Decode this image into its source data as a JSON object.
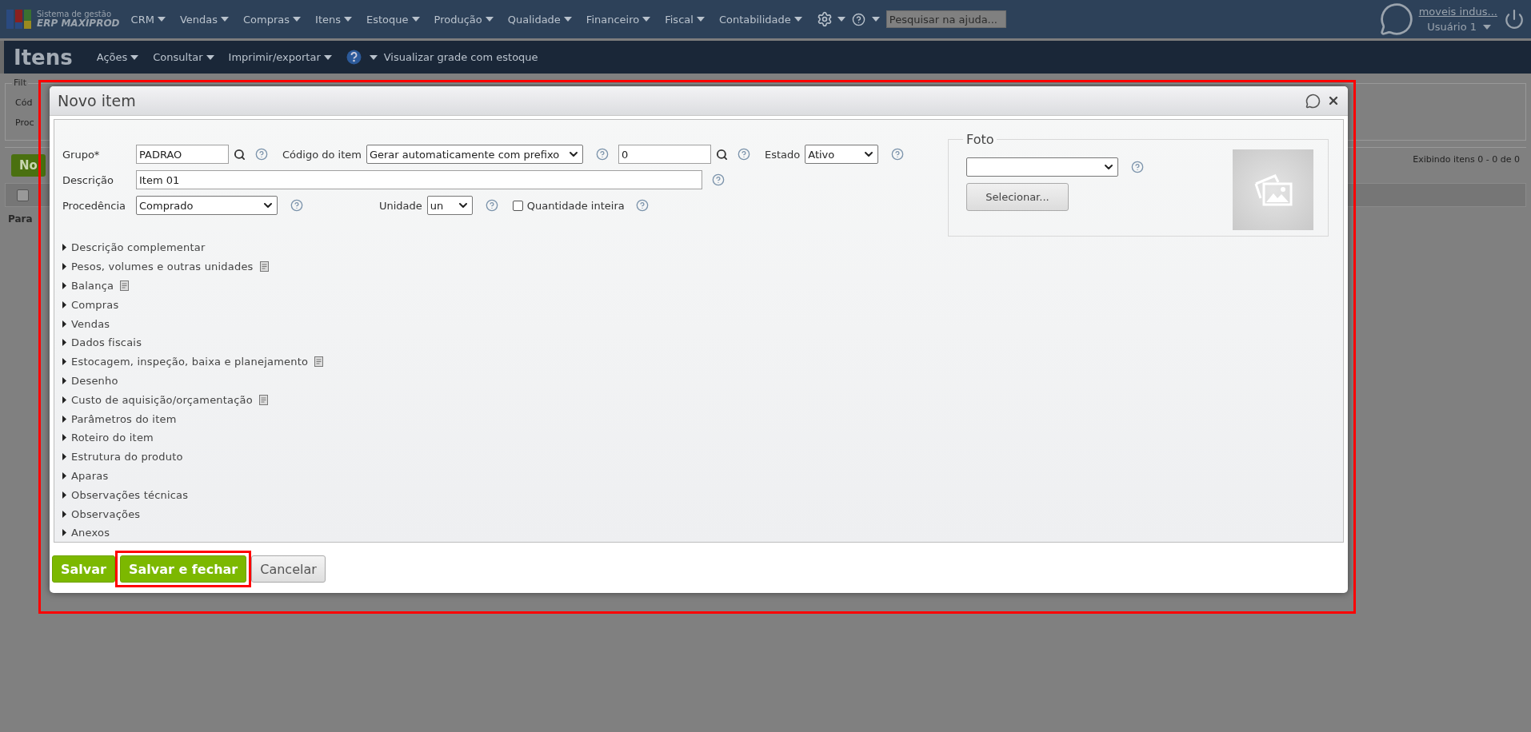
{
  "top_bar": {
    "logo_line1": "Sistema de gestão",
    "logo_line2": "ERP MAXIPROD",
    "menus": [
      "CRM",
      "Vendas",
      "Compras",
      "Itens",
      "Estoque",
      "Produção",
      "Qualidade",
      "Financeiro",
      "Fiscal",
      "Contabilidade"
    ],
    "search_placeholder": "Pesquisar na ajuda...",
    "company_link": "moveis indus...",
    "user": "Usuário 1"
  },
  "page_bar": {
    "title": "Itens",
    "menus": [
      "Ações",
      "Consultar",
      "Imprimir/exportar"
    ],
    "link": "Visualizar grade com estoque"
  },
  "background": {
    "filter_legend": "Filt",
    "filter_rows": [
      "Cód",
      "Proc"
    ],
    "new_button": "No",
    "status": "Exibindo itens 0 - 0 de 0",
    "select_all": {
      "checked": false
    },
    "row_text": "Para"
  },
  "modal": {
    "title": "Novo item",
    "highlighted": true,
    "grupo": {
      "label": "Grupo*",
      "value": "PADRAO"
    },
    "codigo": {
      "label": "Código do item",
      "mode": "Gerar automaticamente com prefixo",
      "value": "0"
    },
    "estado": {
      "label": "Estado",
      "value": "Ativo"
    },
    "descricao": {
      "label": "Descrição",
      "value": "Item 01"
    },
    "procedencia": {
      "label": "Procedência",
      "value": "Comprado"
    },
    "unidade": {
      "label": "Unidade",
      "value": "un"
    },
    "quantidade_inteira": {
      "label": "Quantidade inteira",
      "checked": false
    },
    "foto": {
      "legend": "Foto",
      "select_button": "Selecionar..."
    },
    "sections": [
      {
        "label": "Descrição complementar",
        "has_note": false
      },
      {
        "label": "Pesos, volumes e outras unidades",
        "has_note": true
      },
      {
        "label": "Balança",
        "has_note": true
      },
      {
        "label": "Compras",
        "has_note": false
      },
      {
        "label": "Vendas",
        "has_note": false
      },
      {
        "label": "Dados fiscais",
        "has_note": false
      },
      {
        "label": "Estocagem, inspeção, baixa e planejamento",
        "has_note": true
      },
      {
        "label": "Desenho",
        "has_note": false
      },
      {
        "label": "Custo de aquisição/orçamentação",
        "has_note": true
      },
      {
        "label": "Parâmetros do item",
        "has_note": false
      },
      {
        "label": "Roteiro do item",
        "has_note": false
      },
      {
        "label": "Estrutura do produto",
        "has_note": false
      },
      {
        "label": "Aparas",
        "has_note": false
      },
      {
        "label": "Observações técnicas",
        "has_note": false
      },
      {
        "label": "Observações",
        "has_note": false
      },
      {
        "label": "Anexos",
        "has_note": false
      }
    ],
    "buttons": [
      {
        "label": "Salvar",
        "kind": "primary",
        "highlighted": false
      },
      {
        "label": "Salvar e fechar",
        "kind": "primary",
        "highlighted": true
      },
      {
        "label": "Cancelar",
        "kind": "secondary",
        "highlighted": false
      }
    ]
  }
}
